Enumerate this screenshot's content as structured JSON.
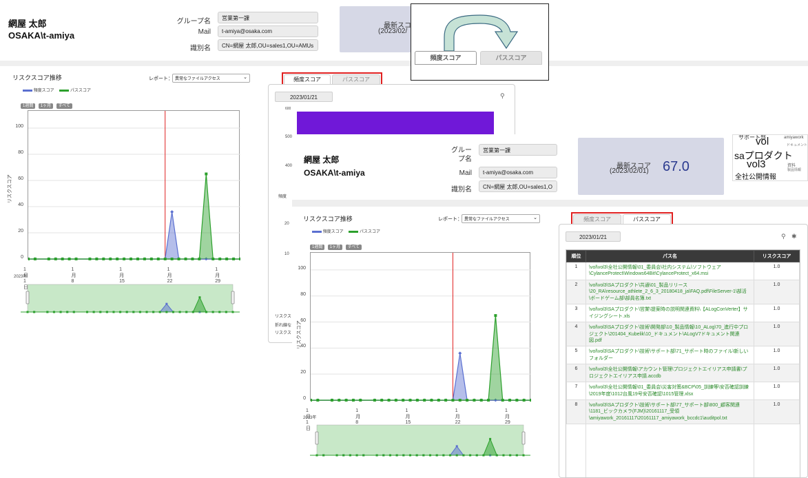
{
  "header": {
    "user_name": "網屋 太郎",
    "account": "OSAKA\\t-amiya",
    "group_label": "グループ名",
    "group_value": "営業第一課",
    "mail_label": "Mail",
    "mail_value": "t-amiya@osaka.com",
    "dn_label": "識別名",
    "dn_value": "CN=網屋 太郎,OU=sales1,OU=AMUs",
    "dn_value_short": "CN=網屋 太郎,OU=sales1,O",
    "group_label_wrapped": "グルー\nプ名",
    "score_title": "最新スコア",
    "score_date": "(2023/02/01)",
    "score_date_cut": "(2023/02/",
    "score_value": "67.0",
    "score_title_cut": "最新スコ"
  },
  "callout": {
    "tab_frequency": "頻度スコア",
    "tab_path": "パススコア"
  },
  "tabs": {
    "frequency": "頻度スコア",
    "path": "パススコア"
  },
  "chart_panel": {
    "title": "リスクスコア推移",
    "report_label": "レポート：",
    "report_select": "異常なファイルアクセス",
    "legend_freq": "頻度スコア",
    "legend_path": "パススコア",
    "btn_week": "1週間",
    "btn_month": "1ヶ月",
    "btn_all": "すべて",
    "ylabel": "リスクスコア",
    "year": "2023年",
    "bottom_note_1": "リスクス",
    "bottom_note_2": "折れ線な",
    "bottom_note_3": "リスクス"
  },
  "detail_panel": {
    "date": "2023/01/21",
    "bar_axis_top": "600",
    "bar_axis_mid": "500",
    "bar_axis_low": "400",
    "bar_axis_label": "頻度",
    "side_val_1": "20",
    "side_val_2": "10"
  },
  "wordcloud": {
    "words": [
      "サポート部",
      "vol",
      "amiyawork",
      "saプロダクト",
      "vol3",
      "全社公開情報",
      "ドキュメント",
      "資料",
      "製品情報"
    ]
  },
  "path_table": {
    "date": "2023/01/21",
    "col_rank": "順位",
    "col_path": "パス名",
    "col_score": "リスクスコア",
    "rows": [
      {
        "rank": "1",
        "path": "\\vol\\vol3\\全社公開情報\\01_委員会\\社内システム\\ソフトウェア\\CylanceProtect\\Windows64Bit\\CylanceProtect_x64.msi",
        "score": "1.0"
      },
      {
        "rank": "2",
        "path": "\\vol\\vol3\\SAプロダクト\\共通\\01_製品リリース\\20_RA\\resource_athlete_2_6_3_20180418_ja\\FAQ.pdf\\FileServer-1\\部活\\ボードゲーム部\\部員名簿.txt",
        "score": "1.0"
      },
      {
        "rank": "3",
        "path": "\\vol\\vol3\\SAプロダクト\\営業\\提案時の説明関連資料\\【ALogConVerter】サイジングシート.xls",
        "score": "1.0"
      },
      {
        "rank": "4",
        "path": "\\vol\\vol3\\SAプロダクト\\技術\\開発部\\10_製品情報\\10_ALog\\70_進行中プロジェクト\\201404_Kubelik\\10_ドキュメント\\ALogV7ドキュメント関連図.pdf",
        "score": "1.0"
      },
      {
        "rank": "5",
        "path": "\\vol\\vol3\\SAプロダクト\\技術\\サポート部\\71_サポート時のファイル\\新しいフォルダー",
        "score": "1.0"
      },
      {
        "rank": "6",
        "path": "\\vol\\vol3\\全社公開情報\\アカウント管理\\プロジェクトエイリアス申請書\\プロジェクトエイリアス申請.accdb",
        "score": "1.0"
      },
      {
        "rank": "7",
        "path": "\\vol\\vol3\\全社公開情報\\01_委員会\\災害対策&BCP\\05_訓練等\\安否確認訓練\\2019年度\\1012台風19号安否確認\\1015管理.xlsx",
        "score": "1.0"
      },
      {
        "rank": "8",
        "path": "\\vol\\vol3\\SAプロダクト\\技術\\サポート部\\77_サポート部\\800_顧客関連\\1181_ビックカメラ(FJM)\\20161117_受領\\amiyawork_20161117\\20161117_amiyawork_bccdc1\\auditpol.txt",
        "score": "1.0"
      }
    ]
  },
  "chart_data": [
    {
      "type": "area",
      "title": "リスクスコア推移",
      "ylabel": "リスクスコア",
      "ylim": [
        0,
        110
      ],
      "yticks": [
        0,
        20,
        40,
        60,
        80,
        100
      ],
      "xticks": [
        "1月1日",
        "1月8日",
        "1月15日",
        "1月22日",
        "1月29日"
      ],
      "x_unit": "2023年1月の日",
      "xlim": [
        1,
        32
      ],
      "marker_day": 21,
      "series": [
        {
          "name": "頻度スコア",
          "color": "#5a6fd0",
          "x": [
            1,
            2,
            4,
            5,
            6,
            7,
            8,
            10,
            11,
            12,
            13,
            14,
            15,
            16,
            17,
            18,
            19,
            20,
            21,
            22,
            23,
            24,
            25,
            26,
            27,
            28,
            29,
            30,
            31,
            32
          ],
          "values": [
            0,
            0,
            0,
            0,
            0,
            0,
            0,
            0,
            0,
            0,
            0,
            0,
            0,
            0,
            0,
            0,
            0,
            0,
            0,
            36,
            0,
            0,
            0,
            0,
            0,
            0,
            0,
            0,
            0,
            0
          ]
        },
        {
          "name": "パススコア",
          "color": "#2ca02c",
          "x": [
            1,
            2,
            4,
            5,
            6,
            7,
            8,
            10,
            11,
            12,
            13,
            14,
            15,
            16,
            17,
            18,
            19,
            20,
            21,
            22,
            23,
            24,
            25,
            26,
            27,
            28,
            29,
            30,
            31,
            32
          ],
          "values": [
            0,
            0,
            0,
            0,
            0,
            0,
            0,
            0,
            0,
            0,
            0,
            0,
            0,
            0,
            0,
            0,
            0,
            0,
            0,
            0,
            0,
            0,
            0,
            0,
            65,
            0,
            0,
            0,
            0,
            0
          ]
        }
      ]
    }
  ]
}
